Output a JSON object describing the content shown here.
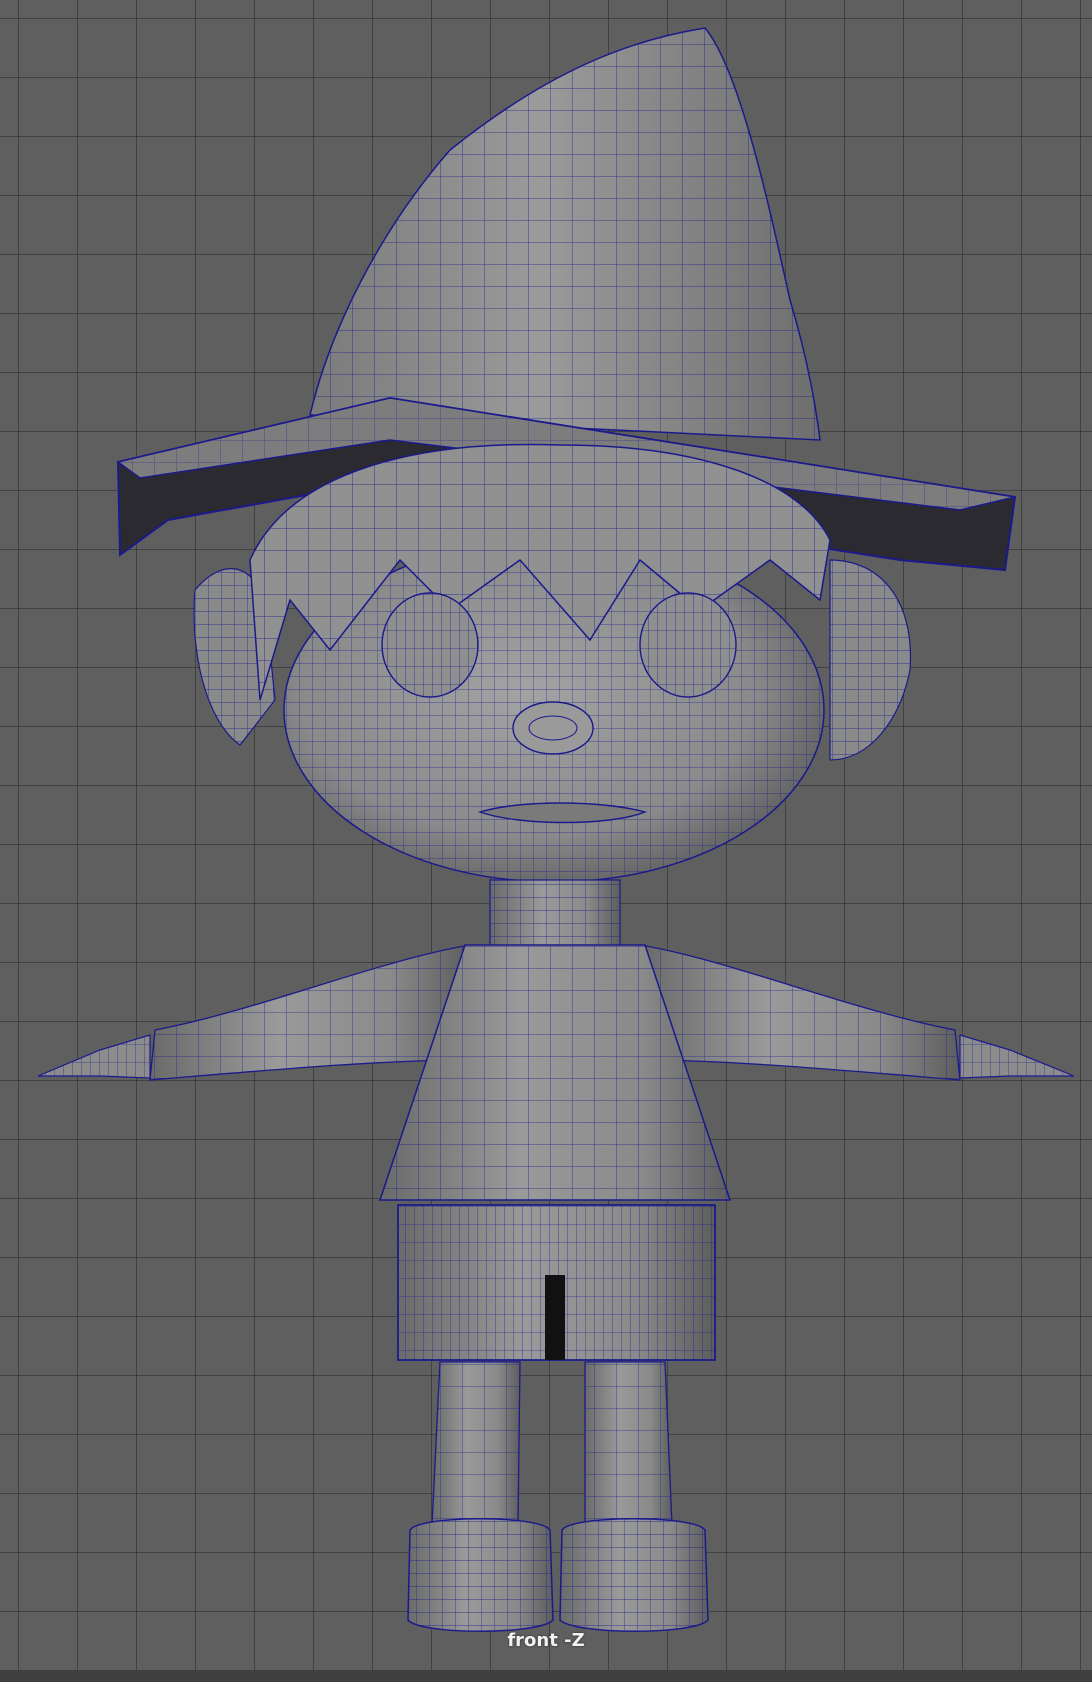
{
  "viewport": {
    "camera_label": "front -Z",
    "background_color": "#5f5f5f",
    "grid_color": "#373737",
    "wire_color": "#1a1a8c",
    "mesh_color": "#8c8c8c"
  }
}
